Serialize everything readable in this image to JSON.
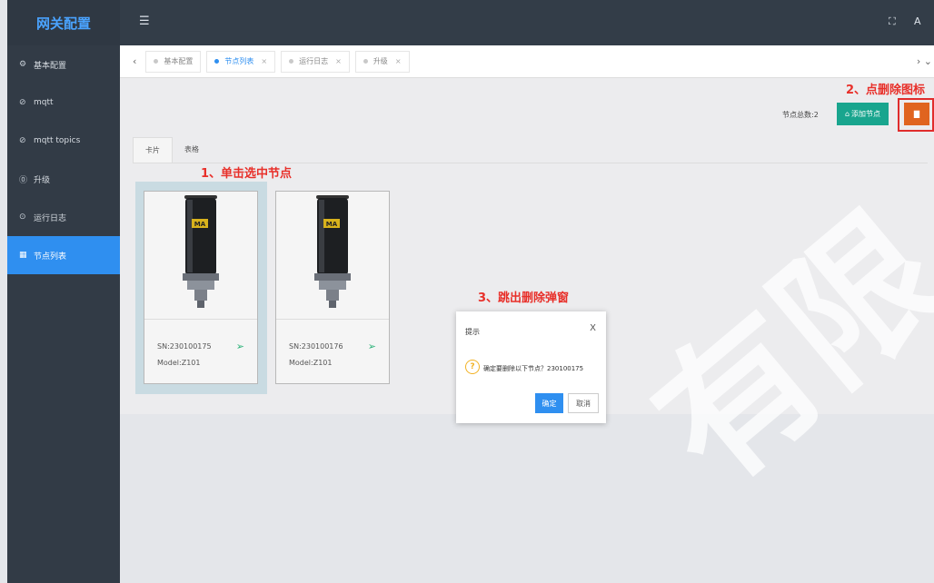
{
  "sidebar": {
    "logo": "网关配置",
    "items": [
      {
        "label": "基本配置",
        "icon": "gear-icon",
        "glyph": "⚙"
      },
      {
        "label": "mqtt",
        "icon": "clock-icon",
        "glyph": "⊘"
      },
      {
        "label": "mqtt topics",
        "icon": "clock-icon",
        "glyph": "⊘"
      },
      {
        "label": "升级",
        "icon": "upgrade-icon",
        "glyph": "⓪"
      },
      {
        "label": "运行日志",
        "icon": "log-icon",
        "glyph": "⊙"
      },
      {
        "label": "节点列表",
        "icon": "list-icon",
        "glyph": "▦"
      }
    ]
  },
  "header": {
    "menu_icon": "☰",
    "fullscreen_icon": "⛶",
    "user_icon": "A"
  },
  "tabs": {
    "left_arrow": "‹",
    "right_arrows": "›  ⌄",
    "items": [
      {
        "label": "基本配置",
        "closable": false
      },
      {
        "label": "节点列表",
        "closable": true
      },
      {
        "label": "运行日志",
        "closable": true
      },
      {
        "label": "升级",
        "closable": true
      }
    ],
    "close_glyph": "×"
  },
  "toolbar": {
    "node_count": "节点总数:2",
    "add_label": "添加节点",
    "delete_icon": "🗑"
  },
  "view_tabs": {
    "card": "卡片",
    "table": "表格"
  },
  "nodes": [
    {
      "sn": "SN:230100175",
      "model": "Model:Z101",
      "badge": "MA"
    },
    {
      "sn": "SN:230100176",
      "model": "Model:Z101",
      "badge": "MA"
    }
  ],
  "annotations": {
    "step1": "1、单击选中节点",
    "step2": "2、点删除图标",
    "step3": "3、跳出删除弹窗"
  },
  "dialog": {
    "title": "提示",
    "close": "X",
    "message": "确定要删除以下节点？230100175",
    "ok": "确定",
    "cancel": "取消"
  },
  "watermark": "有限"
}
